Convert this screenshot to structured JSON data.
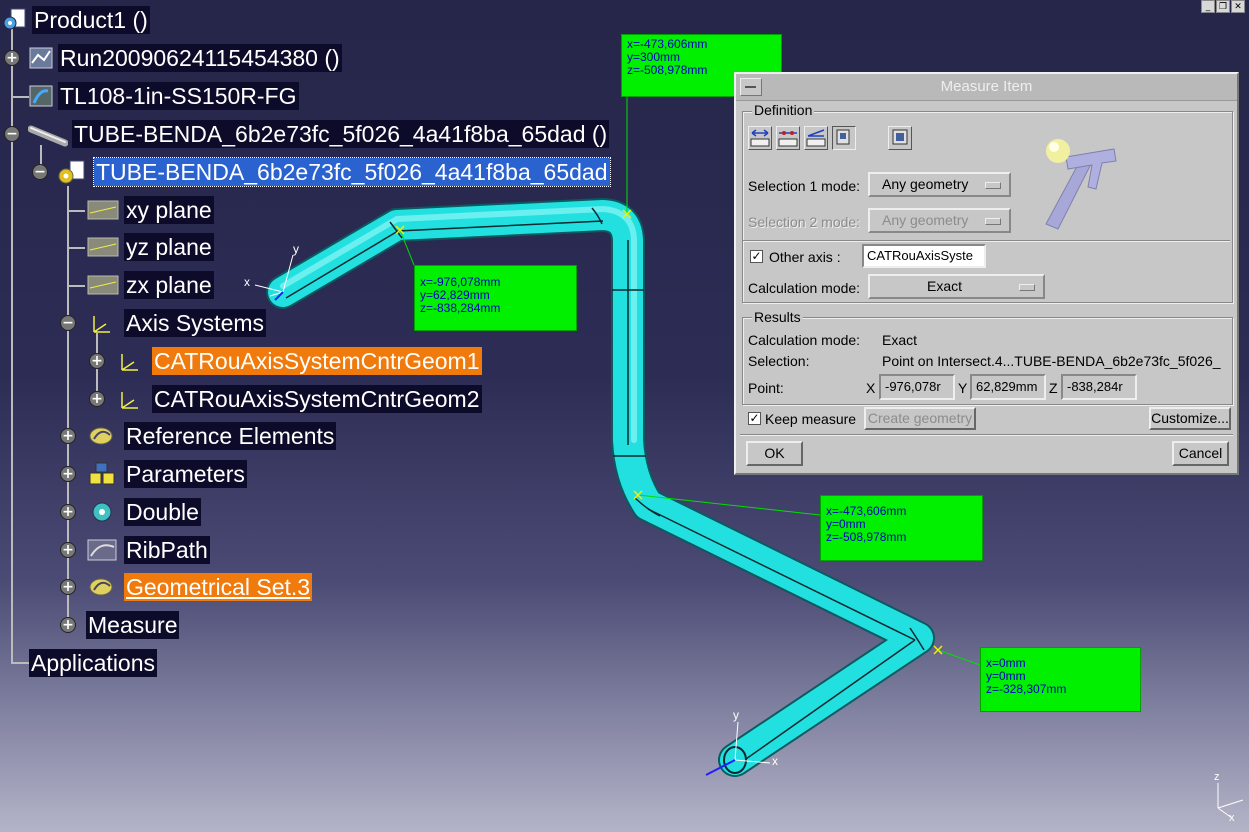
{
  "window_controls": [
    "_",
    "❐",
    "✕"
  ],
  "tree": {
    "root": "Product1 ()",
    "items": [
      {
        "label": "Run20090624115454380 ()"
      },
      {
        "label": "TL108-1in-SS150R-FG"
      },
      {
        "label": "TUBE-BENDA_6b2e73fc_5f026_4a41f8ba_65dad ()"
      },
      {
        "label": "TUBE-BENDA_6b2e73fc_5f026_4a41f8ba_65dad"
      },
      {
        "label": "xy plane"
      },
      {
        "label": "yz plane"
      },
      {
        "label": "zx plane"
      },
      {
        "label": "Axis Systems"
      },
      {
        "label": "CATRouAxisSystemCntrGeom1"
      },
      {
        "label": "CATRouAxisSystemCntrGeom2"
      },
      {
        "label": "Reference Elements"
      },
      {
        "label": "Parameters"
      },
      {
        "label": "Double"
      },
      {
        "label": "RibPath"
      },
      {
        "label": "Geometrical Set.3"
      },
      {
        "label": "Measure"
      },
      {
        "label": "Applications"
      }
    ]
  },
  "measure_labels": [
    {
      "x": "x=-473,606mm",
      "y": "y=300mm",
      "z": "z=-508,978mm"
    },
    {
      "x": "x=-976,078mm",
      "y": "y=62,829mm",
      "z": "z=-838,284mm"
    },
    {
      "x": "x=-473,606mm",
      "y": "y=0mm",
      "z": "z=-508,978mm"
    },
    {
      "x": "x=0mm",
      "y": "y=0mm",
      "z": "z=-328,307mm"
    }
  ],
  "axis_labels": {
    "x": "x",
    "y": "y",
    "z": "z"
  },
  "colors": {
    "tube": "#22e0e0",
    "tube_dark": "#0a7a80",
    "label_bg": "#00f000",
    "selection": "#2a63d0",
    "highlight": "#f07a0c"
  },
  "dialog": {
    "title": "Measure Item",
    "definition_legend": "Definition",
    "selection1_label": "Selection 1 mode:",
    "selection1_value": "Any geometry",
    "selection2_label": "Selection 2 mode:",
    "selection2_value": "Any geometry",
    "other_axis_label": "Other axis :",
    "other_axis_checked": true,
    "other_axis_value": "CATRouAxisSyste",
    "calc_mode_label": "Calculation mode:",
    "calc_mode_value": "Exact",
    "results_legend": "Results",
    "res_calc_label": "Calculation mode:",
    "res_calc_value": "Exact",
    "res_selection_label": "Selection:",
    "res_selection_value": "Point on Intersect.4...TUBE-BENDA_6b2e73fc_5f026_",
    "res_point_label": "Point:",
    "px_label": "X",
    "px_value": "-976,078r",
    "py_label": "Y",
    "py_value": "62,829mm",
    "pz_label": "Z",
    "pz_value": "-838,284r",
    "keep_measure_label": "Keep measure",
    "keep_measure_checked": true,
    "create_geometry_label": "Create geometry",
    "customize_label": "Customize...",
    "ok_label": "OK",
    "cancel_label": "Cancel"
  }
}
